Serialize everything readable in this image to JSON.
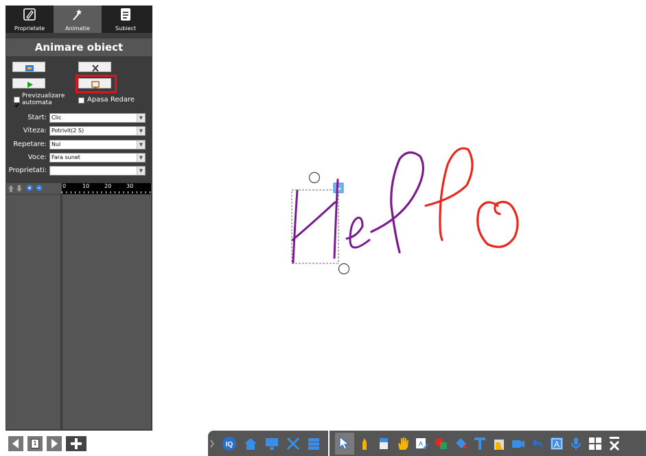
{
  "tabs": [
    {
      "label": "Proprietate",
      "icon": "pencil-icon"
    },
    {
      "label": "Animatie",
      "icon": "wand-icon"
    },
    {
      "label": "Subiect",
      "icon": "document-icon"
    }
  ],
  "panel": {
    "title": "Animare obiect",
    "preview_auto_label_1": "Previzualizare",
    "preview_auto_label_2": "automata",
    "apasa_redare_label": "Apasa Redare",
    "fields": [
      {
        "label": "Start:",
        "value": "Clic"
      },
      {
        "label": "Viteza:",
        "value": "Potrivit(2 S)"
      },
      {
        "label": "Repetare:",
        "value": "Nul"
      },
      {
        "label": "Voce:",
        "value": "Fara sunet"
      },
      {
        "label": "Proprietati:",
        "value": ""
      }
    ],
    "ruler_ticks": [
      "0",
      "10",
      "20",
      "30"
    ]
  },
  "page_nav": {
    "page_number": "1"
  },
  "canvas": {
    "handwriting": "Hello",
    "colors": {
      "purple": "#7b1a8f",
      "red": "#e8281e",
      "highlight": "#e0141c"
    }
  },
  "toolbar_left": [
    "iq-icon",
    "home-icon",
    "monitor-icon",
    "tools-icon",
    "storage-icon"
  ],
  "toolbar_right": [
    "select-arrow-icon",
    "pen-icon",
    "eraser-icon",
    "hand-icon",
    "recognize-icon",
    "shape-icon",
    "fill-icon",
    "text-icon",
    "cleaner-icon",
    "camera-icon",
    "undo-icon",
    "textbox-icon",
    "microphone-icon",
    "grid-icon",
    "close-icon"
  ]
}
